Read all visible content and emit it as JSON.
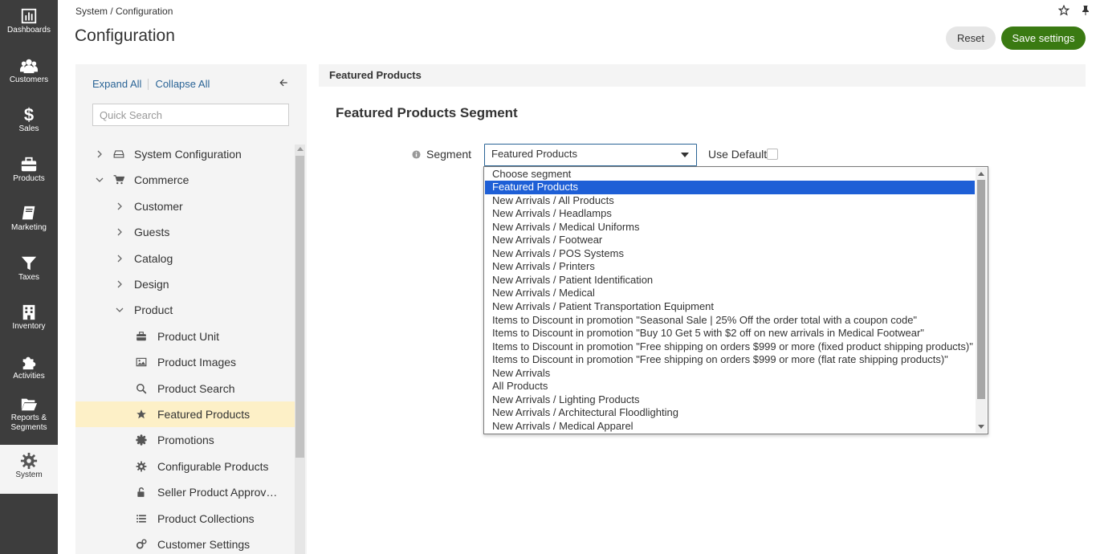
{
  "nav": [
    {
      "label": "Dashboards",
      "icon": "bar-chart-icon"
    },
    {
      "label": "Customers",
      "icon": "users-icon"
    },
    {
      "label": "Sales",
      "icon": "dollar-icon"
    },
    {
      "label": "Products",
      "icon": "briefcase-icon"
    },
    {
      "label": "Marketing",
      "icon": "book-icon"
    },
    {
      "label": "Taxes",
      "icon": "filter-icon"
    },
    {
      "label": "Inventory",
      "icon": "building-icon"
    },
    {
      "label": "Activities",
      "icon": "puzzle-icon"
    },
    {
      "label": "Reports &",
      "label2": "Segments",
      "icon": "folder-open-icon"
    },
    {
      "label": "System",
      "icon": "gear-icon",
      "active": true
    }
  ],
  "header": {
    "breadcrumb": "System / Configuration",
    "title": "Configuration",
    "reset_label": "Reset",
    "save_label": "Save settings"
  },
  "tree": {
    "expand_all": "Expand All",
    "collapse_all": "Collapse All",
    "search_placeholder": "Quick Search",
    "items": [
      {
        "label": "System Configuration",
        "level": 0,
        "chevron": "right",
        "icon": "drive-icon"
      },
      {
        "label": "Commerce",
        "level": 0,
        "chevron": "down",
        "icon": "cart-icon"
      },
      {
        "label": "Customer",
        "level": 1,
        "chevron": "right"
      },
      {
        "label": "Guests",
        "level": 1,
        "chevron": "right"
      },
      {
        "label": "Catalog",
        "level": 1,
        "chevron": "right"
      },
      {
        "label": "Design",
        "level": 1,
        "chevron": "right"
      },
      {
        "label": "Product",
        "level": 1,
        "chevron": "down"
      },
      {
        "label": "Product Unit",
        "level": 2,
        "icon": "briefcase-icon"
      },
      {
        "label": "Product Images",
        "level": 2,
        "icon": "image-icon"
      },
      {
        "label": "Product Search",
        "level": 2,
        "icon": "search-icon"
      },
      {
        "label": "Featured Products",
        "level": 2,
        "icon": "star-icon",
        "selected": true
      },
      {
        "label": "Promotions",
        "level": 2,
        "icon": "badge-icon"
      },
      {
        "label": "Configurable Products",
        "level": 2,
        "icon": "gear-icon"
      },
      {
        "label": "Seller Product Approv…",
        "level": 2,
        "icon": "unlock-icon"
      },
      {
        "label": "Product Collections",
        "level": 2,
        "icon": "list-icon"
      },
      {
        "label": "Customer Settings",
        "level": 2,
        "icon": "gears-icon"
      }
    ]
  },
  "content": {
    "section_bar": "Featured Products",
    "section_title": "Featured Products Segment",
    "segment_label": "Segment",
    "segment_value": "Featured Products",
    "use_default_label": "Use Default",
    "options": [
      "Choose segment",
      "Featured Products",
      "New Arrivals / All Products",
      "New Arrivals / Headlamps",
      "New Arrivals / Medical Uniforms",
      "New Arrivals / Footwear",
      "New Arrivals / POS Systems",
      "New Arrivals / Printers",
      "New Arrivals / Patient Identification",
      "New Arrivals / Medical",
      "New Arrivals / Patient Transportation Equipment",
      "Items to Discount in promotion \"Seasonal Sale | 25% Off the order total with a coupon code\"",
      "Items to Discount in promotion \"Buy 10 Get 5 with $2 off on new arrivals in Medical Footwear\"",
      "Items to Discount in promotion \"Free shipping on orders $999 or more (fixed product shipping products)\"",
      "Items to Discount in promotion \"Free shipping on orders $999 or more (flat rate shipping products)\"",
      "New Arrivals",
      "All Products",
      "New Arrivals / Lighting Products",
      "New Arrivals / Architectural Floodlighting",
      "New Arrivals / Medical Apparel"
    ],
    "highlighted_index": 1
  },
  "colors": {
    "nav_bg": "#3d3d3d",
    "save_green": "#3a7a12",
    "link_blue": "#2a6496",
    "highlight_blue": "#1e5fd6",
    "selected_row": "#fdf0c7"
  }
}
